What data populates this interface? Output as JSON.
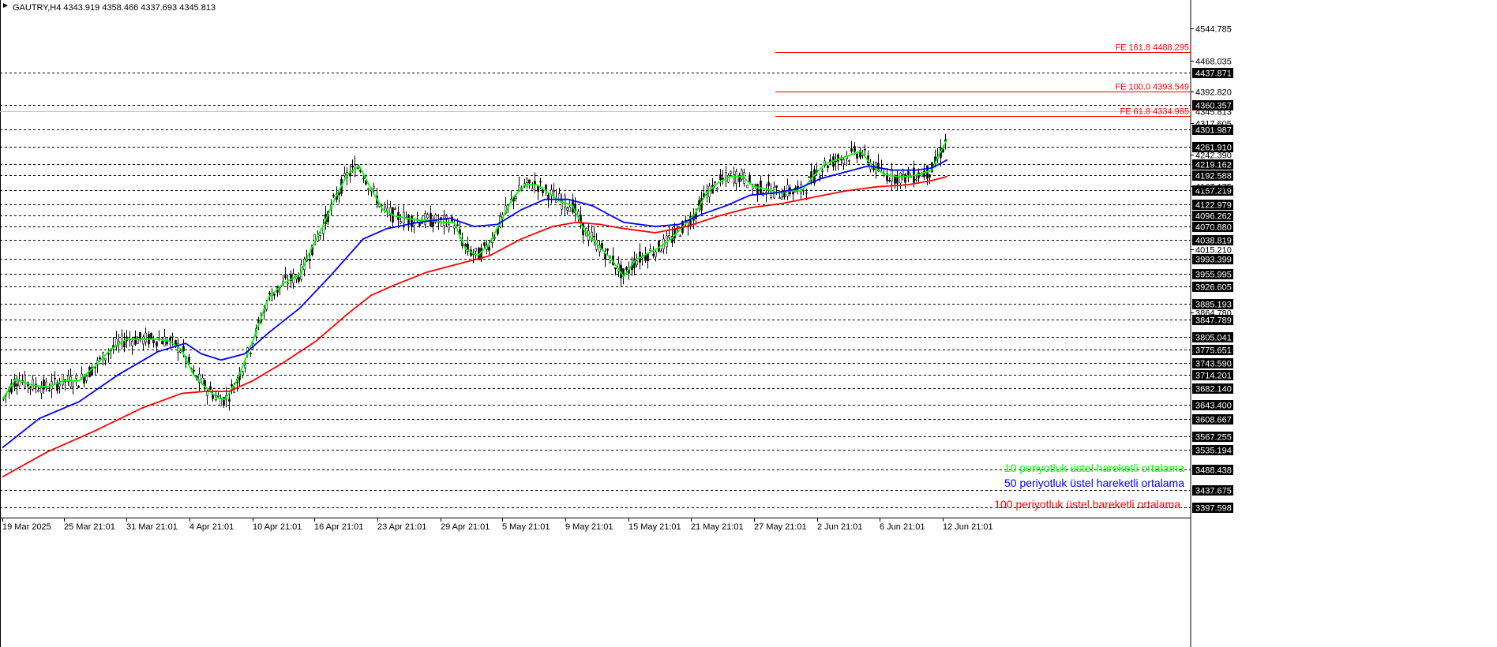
{
  "chart_data": {
    "type": "candlestick",
    "title": "GAUTRY,H4  4343.919 4358.466 4337.693 4345.813",
    "y_range": [
      3380,
      4590
    ],
    "x_ticks": [
      "19 Mar 2025",
      "25 Mar 21:01",
      "31 Mar 21:01",
      "4 Apr 21:01",
      "10 Apr 21:01",
      "16 Apr 21:01",
      "23 Apr 21:01",
      "29 Apr 21:01",
      "5 May 21:01",
      "9 May 21:01",
      "15 May 21:01",
      "21 May 21:01",
      "27 May 21:01",
      "2 Jun 21:01",
      "6 Jun 21:01",
      "12 Jun 21:01"
    ],
    "y_ticks": [
      "4544.785",
      "4468.035",
      "4392.820",
      "4317.605",
      "4242.390",
      "4167.175",
      "4015.210",
      "3864.780"
    ],
    "last_price": "4345.813",
    "levels": [
      "4437.871",
      "4360.357",
      "4301.987",
      "4261.910",
      "4219.162",
      "4192.588",
      "4157.219",
      "4122.979",
      "4096.262",
      "4070.880",
      "4038.819",
      "3993.399",
      "3955.995",
      "3926.605",
      "3885.193",
      "3847.789",
      "3805.041",
      "3775.651",
      "3743.590",
      "3714.201",
      "3682.140",
      "3643.400",
      "3608.667",
      "3567.255",
      "3535.194",
      "3488.438",
      "3437.675",
      "3397.598"
    ],
    "fibonacci": [
      {
        "label": "FE 161.8 4488.295",
        "value": 4488.295
      },
      {
        "label": "FE 100.0 4393.549",
        "value": 4393.549
      },
      {
        "label": "FE 61.8 4334.985",
        "value": 4334.985
      }
    ],
    "series": [
      {
        "name": "10 periyotluk üstel hareketli ortalama",
        "color": "#00ff00",
        "points": [
          [
            3,
            3655
          ],
          [
            20,
            3705
          ],
          [
            40,
            3690
          ],
          [
            60,
            3685
          ],
          [
            80,
            3700
          ],
          [
            100,
            3700
          ],
          [
            120,
            3735
          ],
          [
            140,
            3775
          ],
          [
            160,
            3800
          ],
          [
            180,
            3800
          ],
          [
            200,
            3800
          ],
          [
            215,
            3795
          ],
          [
            230,
            3775
          ],
          [
            245,
            3715
          ],
          [
            260,
            3685
          ],
          [
            275,
            3660
          ],
          [
            285,
            3655
          ],
          [
            300,
            3700
          ],
          [
            320,
            3795
          ],
          [
            340,
            3900
          ],
          [
            360,
            3935
          ],
          [
            380,
            3955
          ],
          [
            395,
            4020
          ],
          [
            410,
            4075
          ],
          [
            425,
            4140
          ],
          [
            440,
            4195
          ],
          [
            455,
            4215
          ],
          [
            470,
            4160
          ],
          [
            485,
            4110
          ],
          [
            500,
            4095
          ],
          [
            515,
            4090
          ],
          [
            530,
            4085
          ],
          [
            545,
            4085
          ],
          [
            560,
            4080
          ],
          [
            575,
            4080
          ],
          [
            590,
            4015
          ],
          [
            605,
            4000
          ],
          [
            620,
            4030
          ],
          [
            635,
            4085
          ],
          [
            650,
            4140
          ],
          [
            665,
            4170
          ],
          [
            680,
            4170
          ],
          [
            695,
            4150
          ],
          [
            710,
            4130
          ],
          [
            725,
            4120
          ],
          [
            740,
            4060
          ],
          [
            760,
            4020
          ],
          [
            775,
            3990
          ],
          [
            790,
            3950
          ],
          [
            805,
            3990
          ],
          [
            820,
            4005
          ],
          [
            835,
            4020
          ],
          [
            850,
            4040
          ],
          [
            865,
            4070
          ],
          [
            880,
            4100
          ],
          [
            895,
            4150
          ],
          [
            910,
            4175
          ],
          [
            925,
            4190
          ],
          [
            940,
            4190
          ],
          [
            955,
            4165
          ],
          [
            970,
            4160
          ],
          [
            985,
            4150
          ],
          [
            1000,
            4155
          ],
          [
            1015,
            4155
          ],
          [
            1030,
            4190
          ],
          [
            1045,
            4220
          ],
          [
            1060,
            4230
          ],
          [
            1075,
            4240
          ],
          [
            1090,
            4250
          ],
          [
            1105,
            4215
          ],
          [
            1120,
            4195
          ],
          [
            1135,
            4190
          ],
          [
            1150,
            4190
          ],
          [
            1165,
            4195
          ],
          [
            1180,
            4205
          ],
          [
            1190,
            4245
          ],
          [
            1200,
            4280
          ]
        ]
      },
      {
        "name": "50 periyotluk üstel hareketli ortalama",
        "color": "#0000ff",
        "points": [
          [
            3,
            3540
          ],
          [
            50,
            3610
          ],
          [
            100,
            3650
          ],
          [
            150,
            3715
          ],
          [
            200,
            3770
          ],
          [
            235,
            3790
          ],
          [
            255,
            3765
          ],
          [
            280,
            3750
          ],
          [
            310,
            3765
          ],
          [
            340,
            3815
          ],
          [
            380,
            3875
          ],
          [
            420,
            3955
          ],
          [
            460,
            4040
          ],
          [
            490,
            4065
          ],
          [
            530,
            4080
          ],
          [
            570,
            4090
          ],
          [
            600,
            4070
          ],
          [
            630,
            4075
          ],
          [
            660,
            4110
          ],
          [
            690,
            4135
          ],
          [
            720,
            4135
          ],
          [
            750,
            4120
          ],
          [
            790,
            4080
          ],
          [
            830,
            4070
          ],
          [
            860,
            4075
          ],
          [
            890,
            4100
          ],
          [
            920,
            4120
          ],
          [
            950,
            4145
          ],
          [
            980,
            4150
          ],
          [
            1010,
            4160
          ],
          [
            1040,
            4185
          ],
          [
            1070,
            4200
          ],
          [
            1100,
            4215
          ],
          [
            1130,
            4205
          ],
          [
            1160,
            4205
          ],
          [
            1180,
            4210
          ],
          [
            1200,
            4230
          ]
        ]
      },
      {
        "name": "100 periyotluk üstel hareketli ortalama",
        "color": "#ff0000",
        "points": [
          [
            3,
            3470
          ],
          [
            60,
            3530
          ],
          [
            120,
            3580
          ],
          [
            180,
            3635
          ],
          [
            230,
            3670
          ],
          [
            260,
            3675
          ],
          [
            290,
            3675
          ],
          [
            320,
            3700
          ],
          [
            360,
            3745
          ],
          [
            400,
            3795
          ],
          [
            440,
            3860
          ],
          [
            470,
            3905
          ],
          [
            500,
            3930
          ],
          [
            540,
            3960
          ],
          [
            580,
            3980
          ],
          [
            620,
            4000
          ],
          [
            660,
            4040
          ],
          [
            700,
            4070
          ],
          [
            730,
            4080
          ],
          [
            760,
            4075
          ],
          [
            790,
            4065
          ],
          [
            830,
            4055
          ],
          [
            870,
            4070
          ],
          [
            910,
            4095
          ],
          [
            950,
            4115
          ],
          [
            990,
            4125
          ],
          [
            1030,
            4140
          ],
          [
            1070,
            4155
          ],
          [
            1110,
            4165
          ],
          [
            1150,
            4170
          ],
          [
            1180,
            4180
          ],
          [
            1200,
            4190
          ]
        ]
      }
    ],
    "legend_placement": "bottom-right"
  }
}
